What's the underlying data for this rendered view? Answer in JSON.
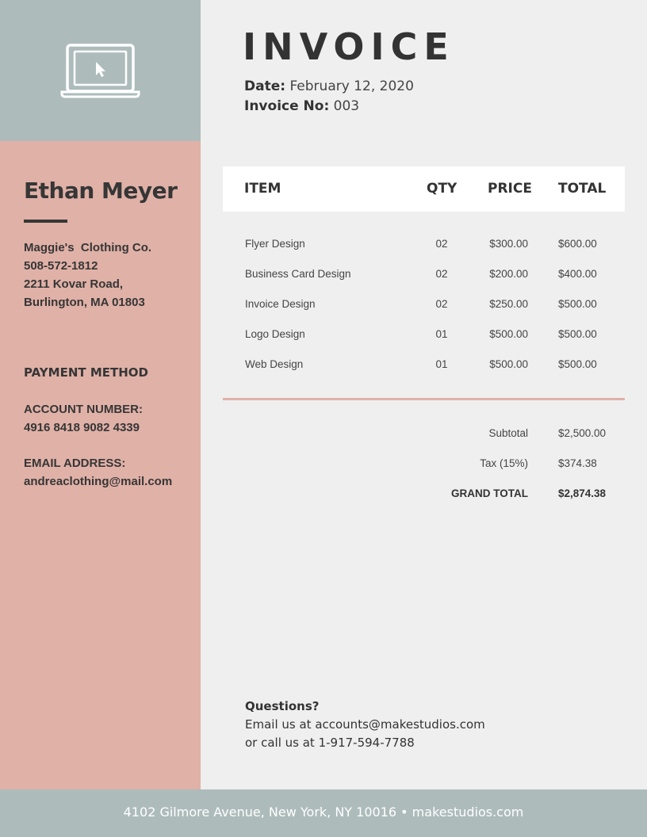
{
  "invoice": {
    "title": "INVOICE",
    "date_label": "Date:",
    "date_value": "February 12, 2020",
    "number_label": "Invoice No:",
    "number_value": "003"
  },
  "client": {
    "name": "Ethan Meyer",
    "company": "Maggie's  Clothing Co.",
    "phone": "508-572-1812",
    "address_line1": "2211 Kovar Road,",
    "address_line2": "Burlington, MA 01803"
  },
  "payment": {
    "heading": "PAYMENT METHOD",
    "account_label": "ACCOUNT NUMBER:",
    "account_value": "4916 8418 9082 4339",
    "email_label": "EMAIL ADDRESS:",
    "email_value": "andreaclothing@mail.com"
  },
  "table": {
    "headers": {
      "item": "ITEM",
      "qty": "QTY",
      "price": "PRICE",
      "total": "TOTAL"
    },
    "rows": [
      {
        "item": "Flyer Design",
        "qty": "02",
        "price": "$300.00",
        "total": "$600.00"
      },
      {
        "item": "Business Card Design",
        "qty": "02",
        "price": "$200.00",
        "total": "$400.00"
      },
      {
        "item": "Invoice Design",
        "qty": "02",
        "price": "$250.00",
        "total": "$500.00"
      },
      {
        "item": "Logo Design",
        "qty": "01",
        "price": "$500.00",
        "total": "$500.00"
      },
      {
        "item": "Web Design",
        "qty": "01",
        "price": "$500.00",
        "total": "$500.00"
      }
    ]
  },
  "summary": {
    "subtotal_label": "Subtotal",
    "subtotal_value": "$2,500.00",
    "tax_label": "Tax (15%)",
    "tax_value": "$374.38",
    "grand_label": "GRAND TOTAL",
    "grand_value": "$2,874.38"
  },
  "questions": {
    "heading": "Questions?",
    "line1": "Email us at accounts@makestudios.com",
    "line2": "or call us at 1-917-594-7788"
  },
  "footer": {
    "text": "4102 Gilmore Avenue, New York, NY 10016 • makestudios.com"
  },
  "colors": {
    "sidebar_top": "#adbcbb",
    "sidebar": "#e0b1a7",
    "page": "#efefef",
    "accent_divider": "#e0b1a7",
    "text_dark": "#333333"
  },
  "icons": {
    "logo": "laptop-cursor-icon"
  }
}
